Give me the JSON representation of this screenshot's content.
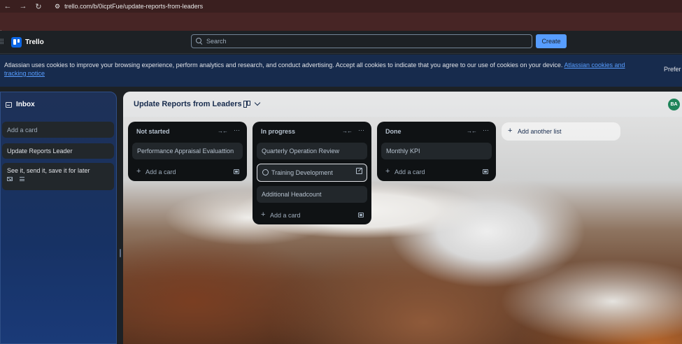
{
  "browser": {
    "back": "←",
    "forward": "→",
    "reload": "↻",
    "url": "trello.com/b/0icptFue/update-reports-from-leaders"
  },
  "header": {
    "logo_text": "Trello",
    "search_placeholder": "Search",
    "create_label": "Create"
  },
  "cookie_banner": {
    "text": "Atlassian uses cookies to improve your browsing experience, perform analytics and research, and conduct advertising. Accept all cookies to indicate that you agree to our use of cookies on your device.",
    "link": "Atlassian cookies and tracking notice",
    "preferences": "Prefer"
  },
  "inbox": {
    "title": "Inbox",
    "add_placeholder": "Add a card",
    "cards": [
      {
        "title": "Update Reports Leader"
      },
      {
        "title": "See it, send it, save it for later"
      }
    ]
  },
  "board": {
    "title": "Update Reports from Leaders",
    "avatar_initials": "BA",
    "add_list_label": "Add another list",
    "lists": [
      {
        "title": "Not started",
        "cards": [
          "Performance Appraisal Evaluattion"
        ],
        "add_label": "Add a card"
      },
      {
        "title": "In progress",
        "cards": [
          "Quarterly Operation Review",
          "Training Development",
          "Additional Headcount"
        ],
        "add_label": "Add a card"
      },
      {
        "title": "Done",
        "cards": [
          "Monthly KPI"
        ],
        "add_label": "Add a card"
      }
    ]
  },
  "colors": {
    "accent": "#579dff",
    "brand": "#0c66e4",
    "avatar": "#1f845a"
  }
}
